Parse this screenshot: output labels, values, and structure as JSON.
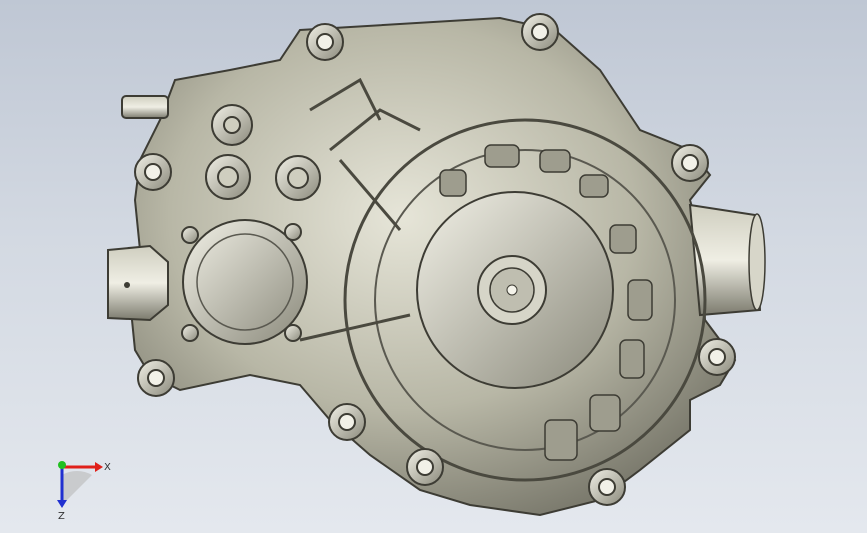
{
  "viewport": {
    "background_top": "#bfc7d4",
    "background_bottom": "#e4e8ee",
    "model_color": "#b9b8a8"
  },
  "triad": {
    "x_label": "X",
    "z_label": "Z",
    "x_color": "#e0201a",
    "y_color": "#20c020",
    "z_color": "#2030d0"
  }
}
